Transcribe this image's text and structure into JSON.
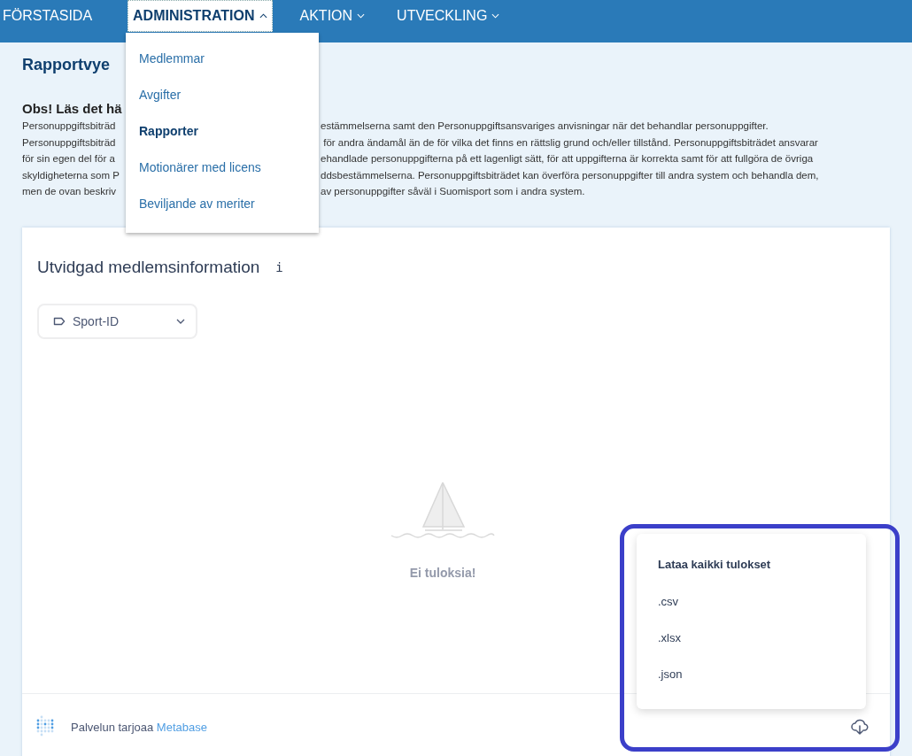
{
  "nav": [
    {
      "label": "FÖRSTASIDA",
      "kind": "link",
      "selected": false
    },
    {
      "label": "ADMINISTRATION",
      "kind": "menu",
      "selected": true,
      "expanded": true
    },
    {
      "label": "AKTION",
      "kind": "menu",
      "selected": false,
      "expanded": false
    },
    {
      "label": "UTVECKLING",
      "kind": "menu",
      "selected": false,
      "expanded": false
    }
  ],
  "admin_menu": {
    "items": [
      {
        "label": "Medlemmar",
        "selected": false
      },
      {
        "label": "Avgifter",
        "selected": false
      },
      {
        "label": "Rapporter",
        "selected": true
      },
      {
        "label": "Motionärer med licens",
        "selected": false
      },
      {
        "label": "Beviljande av meriter",
        "selected": false
      }
    ]
  },
  "page": {
    "title": "Rapportvye",
    "notice_title": "Obs! Läs det hä",
    "notice_lines": [
      {
        "left": "Personuppgiftsbiträd",
        "right": "estämmelserna samt den Personuppgiftsansvariges anvisningar när det behandlar personuppgifter."
      },
      {
        "left": "Personuppgiftsbiträd",
        "right": " för andra ändamål än de för vilka det finns en rättslig grund och/eller tillstånd. Personuppgiftsbiträdet ansvarar"
      },
      {
        "left": "för sin egen del för a",
        "right": "ehandlade personuppgifterna på ett lagenligt sätt, för att uppgifterna är korrekta samt för att fullgöra de övriga"
      },
      {
        "left": "skyldigheterna som P",
        "right": "ddsbestämmelserna. Personuppgiftsbiträdet kan överföra personuppgifter till andra system och behandla dem,"
      },
      {
        "left": "men de ovan beskriv",
        "right": "av personuppgifter såväl i Suomisport som i andra system."
      }
    ]
  },
  "card": {
    "title": "Utvidgad medlemsinformation",
    "info": "i",
    "filter": {
      "label": "Sport-ID"
    },
    "empty_message": "Ei tuloksia!",
    "footer": {
      "text": "Palvelun tarjoaa",
      "link": "Metabase"
    },
    "download_menu": {
      "title": "Lataa kaikki tulokset",
      "options": [
        ".csv",
        ".xlsx",
        ".json"
      ]
    }
  }
}
